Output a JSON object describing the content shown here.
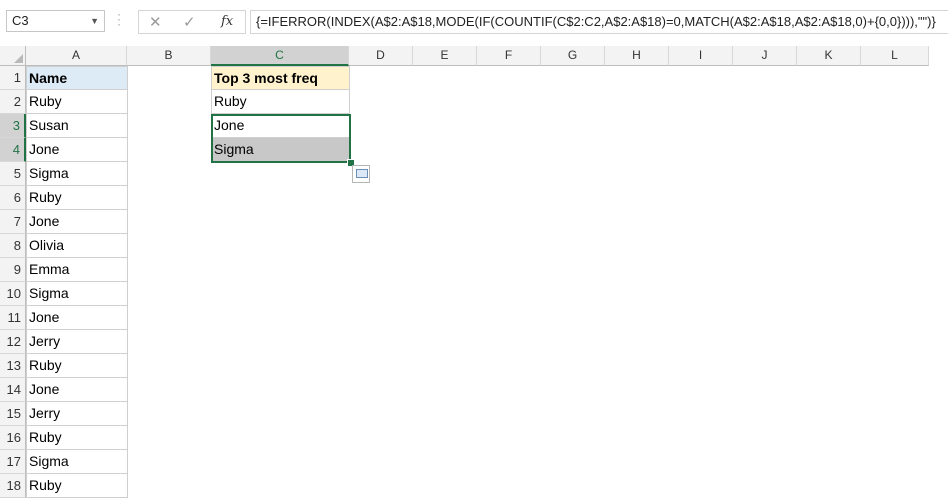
{
  "formula_bar": {
    "name_box": "C3",
    "cancel_glyph": "✕",
    "enter_glyph": "✓",
    "fx_label": "fx",
    "formula": "{=IFERROR(INDEX(A$2:A$18,MODE(IF(COUNTIF(C$2:C2,A$2:A$18)=0,MATCH(A$2:A$18,A$2:A$18,0)+{0,0}))),\"\")}"
  },
  "columns": [
    "A",
    "B",
    "C",
    "D",
    "E",
    "F",
    "G",
    "H",
    "I",
    "J",
    "K",
    "L"
  ],
  "rows": [
    "1",
    "2",
    "3",
    "4",
    "5",
    "6",
    "7",
    "8",
    "9",
    "10",
    "11",
    "12",
    "13",
    "14",
    "15",
    "16",
    "17",
    "18"
  ],
  "col_a": {
    "header": "Name",
    "values": [
      "Ruby",
      "Susan",
      "Jone",
      "Sigma",
      "Ruby",
      "Jone",
      "Olivia",
      "Emma",
      "Sigma",
      "Jone",
      "Jerry",
      "Ruby",
      "Jone",
      "Jerry",
      "Ruby",
      "Sigma",
      "Ruby"
    ]
  },
  "col_c": {
    "header": "Top 3 most freq",
    "values": [
      "Ruby",
      "Jone",
      "Sigma"
    ]
  },
  "colors": {
    "selection": "#217346",
    "header_a": "#ddebf7",
    "header_c": "#fff2cc"
  }
}
